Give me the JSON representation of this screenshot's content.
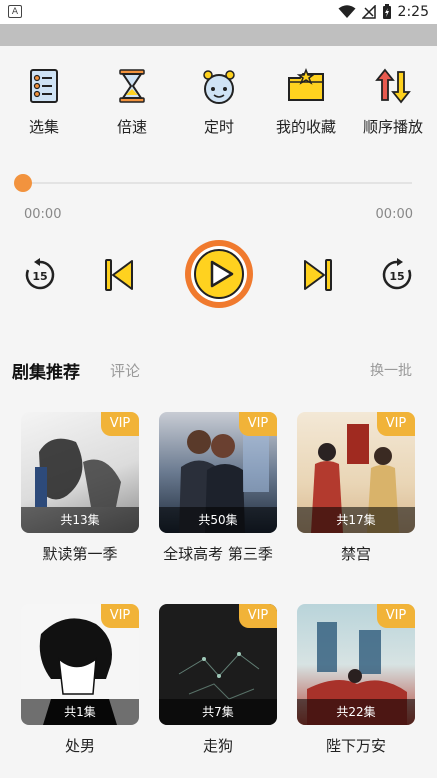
{
  "status_bar": {
    "app_indicator": "A",
    "time": "2:25"
  },
  "toolbar": [
    {
      "label": "选集",
      "icon": "playlist-icon"
    },
    {
      "label": "倍速",
      "icon": "hourglass-icon"
    },
    {
      "label": "定时",
      "icon": "alarm-clock-icon"
    },
    {
      "label": "我的收藏",
      "icon": "favorites-folder-icon"
    },
    {
      "label": "顺序播放",
      "icon": "sequence-arrows-icon"
    }
  ],
  "player": {
    "progress": 0,
    "current_time": "00:00",
    "total_time": "00:00",
    "rewind_seconds": "15",
    "forward_seconds": "15"
  },
  "section": {
    "title": "剧集推荐",
    "tab_comments": "评论",
    "refresh": "换一批"
  },
  "cards": [
    {
      "title": "默读第一季",
      "count": "共13集",
      "vip": "VIP"
    },
    {
      "title": "全球高考 第三季",
      "count": "共50集",
      "vip": "VIP"
    },
    {
      "title": "禁宫",
      "count": "共17集",
      "vip": "VIP"
    },
    {
      "title": "处男",
      "count": "共1集",
      "vip": "VIP"
    },
    {
      "title": "走狗",
      "count": "共7集",
      "vip": "VIP"
    },
    {
      "title": "陛下万安",
      "count": "共22集",
      "vip": "VIP"
    }
  ],
  "colors": {
    "accent": "#f2933e",
    "vip": "#f1b338",
    "play_yellow": "#ffd21f"
  }
}
